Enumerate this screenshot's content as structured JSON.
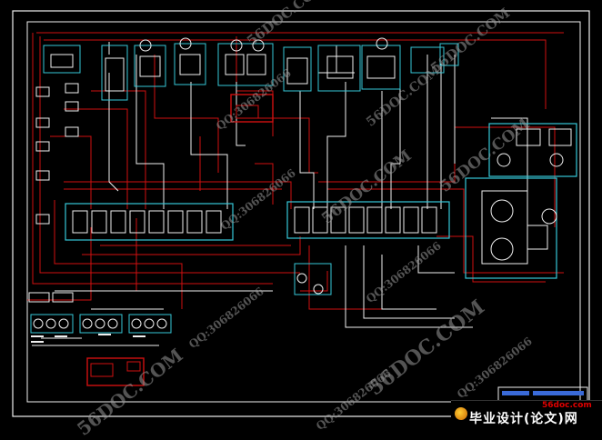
{
  "watermarks": [
    {
      "id": "wm-1",
      "text": "56DOC.COM"
    },
    {
      "id": "wm-2",
      "text": "56DOC.COM"
    },
    {
      "id": "wm-3",
      "text": "56DOC.COM"
    },
    {
      "id": "wm-4",
      "text": "56DOC.COM"
    },
    {
      "id": "wm-5",
      "text": "56DOC.COM"
    },
    {
      "id": "wm-6",
      "text": "56DOC.COM"
    },
    {
      "id": "wm-7",
      "text": "56DOC.COM"
    },
    {
      "id": "wm-8",
      "text": "QQ:306826066"
    },
    {
      "id": "wm-9",
      "text": "QQ:306826066"
    },
    {
      "id": "wm-10",
      "text": "QQ:306826066"
    },
    {
      "id": "wm-11",
      "text": "QQ:306826066"
    },
    {
      "id": "wm-12",
      "text": "QQ:306826066"
    },
    {
      "id": "wm-13",
      "text": "QQ:306826066"
    }
  ],
  "brand": {
    "domain": "56doc.com",
    "name": "毕业设计(论文)网"
  },
  "colors": {
    "background": "#000000",
    "frame": "#ffffff",
    "red_line": "#d01010",
    "cyan_box": "#36c8d8",
    "white_line": "#f0f0f0"
  }
}
